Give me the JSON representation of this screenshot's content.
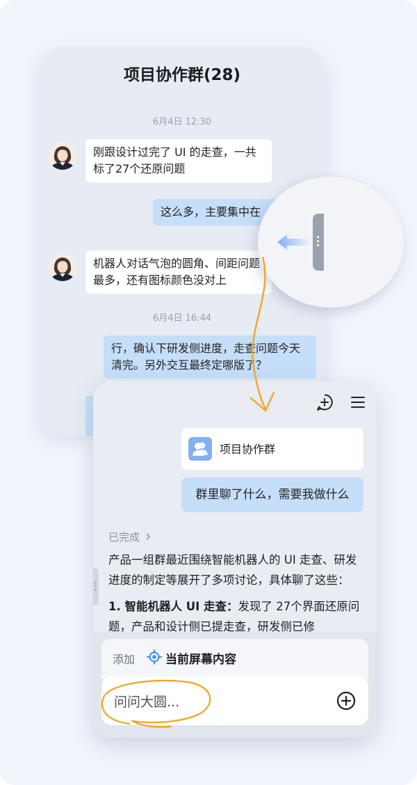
{
  "group_chat": {
    "title": "项目协作群(28)",
    "messages": [
      {
        "type": "timestamp",
        "text": "6月4日 12:30"
      },
      {
        "type": "received",
        "text": "刚跟设计过完了 UI 的走查，一共标了27个还原问题"
      },
      {
        "type": "sent",
        "text": "这么多，主要集中在"
      },
      {
        "type": "received",
        "text": "机器人对话气泡的圆角、间距问题最多，还有图标颜色没对上"
      },
      {
        "type": "timestamp",
        "text": "6月4日 16:44"
      },
      {
        "type": "sent",
        "text": "行，确认下研发侧进度，走查问题今天清完。另外交互最终定哪版了？"
      }
    ]
  },
  "assistant": {
    "header_icons": [
      "new-chat-icon",
      "menu-icon"
    ],
    "context_card": {
      "icon": "group-icon",
      "label": "项目协作群"
    },
    "user_message": "群里聊了什么，需要我做什么",
    "status": {
      "label": "已完成",
      "icon": "chevron-right-icon"
    },
    "answer": {
      "intro": "产品一组群最近围绕智能机器人的 UI 走查、研发进度的制定等展开了多项讨论，具体聊了这些：",
      "item1_title": "1. 智能机器人 UI 走查：",
      "item1_text": "发现了 27个界面还原问题，产品和设计侧已提走查，研发侧已修"
    },
    "add_bar": {
      "label": "添加",
      "chip_icon": "target-icon",
      "chip_label": "当前屏幕内容"
    },
    "input": {
      "placeholder": "问问大圆...",
      "plus_icon": "plus-circle-icon"
    }
  },
  "colors": {
    "background": "#f1f4fb",
    "sent_bubble": "#c5def9",
    "received_bubble": "#ffffff",
    "annotation": "#f2a623",
    "group_icon": "#84b1ef",
    "target_icon": "#3f8ef1"
  }
}
